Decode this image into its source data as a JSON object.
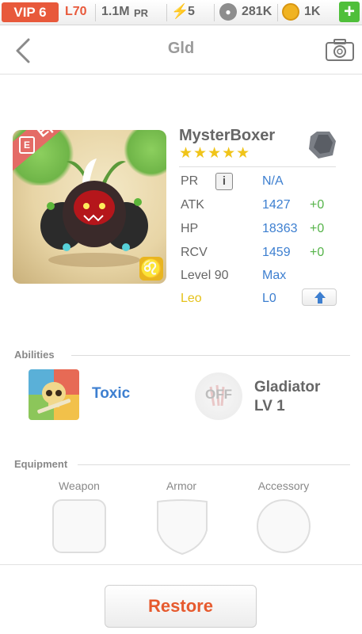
{
  "status_bar": {
    "vip": "VIP 6",
    "level": "L70",
    "power": "1.1M",
    "power_suffix": "PR",
    "energy": "5",
    "food": "281K",
    "gold": "1K",
    "add": "+"
  },
  "header": {
    "title": "Gld"
  },
  "monster": {
    "name": "MysterBoxer",
    "stars": 5,
    "rarity": "Epic",
    "stats": [
      {
        "label": "PR",
        "value": "N/A",
        "bonus": ""
      },
      {
        "label": "ATK",
        "value": "1427",
        "bonus": "+0"
      },
      {
        "label": "HP",
        "value": "18363",
        "bonus": "+0"
      },
      {
        "label": "RCV",
        "value": "1459",
        "bonus": "+0"
      }
    ],
    "level_label": "Level 90",
    "level_value": "Max",
    "zodiac_label": "Leo",
    "zodiac_value": "L0"
  },
  "abilities": {
    "heading": "Abilities",
    "skill_name": "Toxic",
    "passive_state": "OFF",
    "passive_name": "Gladiator",
    "passive_level": "LV 1"
  },
  "equipment": {
    "heading": "Equipment",
    "slots": [
      "Weapon",
      "Armor",
      "Accessory"
    ]
  },
  "footer": {
    "restore": "Restore"
  },
  "colors": {
    "accent_orange": "#e65a2e",
    "value_blue": "#3d7fd0",
    "bonus_green": "#56b44a",
    "zodiac_yellow": "#e5c21a",
    "vip_red": "#e8593b"
  }
}
